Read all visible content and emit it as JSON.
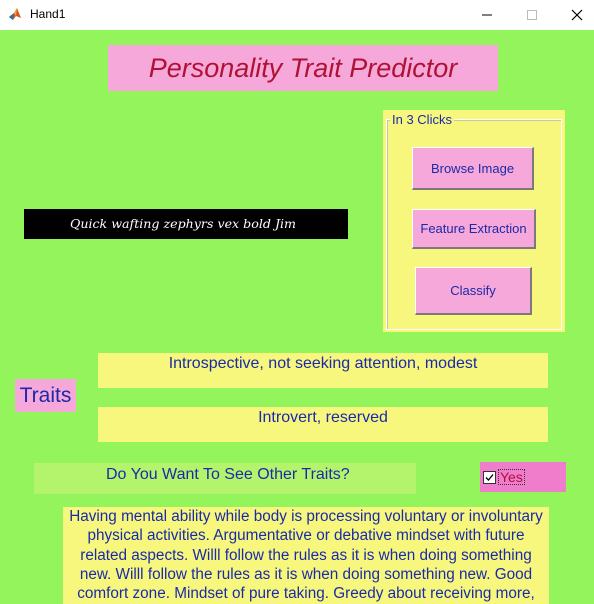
{
  "window": {
    "title": "Hand1",
    "icon": "matlab-icon"
  },
  "header": {
    "title": "Personality Trait Predictor"
  },
  "panel": {
    "legend": "In 3 Clicks",
    "buttons": {
      "browse": "Browse Image",
      "feature": "Feature Extraction",
      "classify": "Classify"
    }
  },
  "handwriting": {
    "text": "Quick wafting zephyrs vex bold Jim"
  },
  "traits": {
    "label": "Traits",
    "items": [
      "Introspective, not seeking attention, modest",
      "Introvert, reserved"
    ]
  },
  "other_traits": {
    "question": "Do You Want To See Other Traits?",
    "checkbox_label": "Yes",
    "checked": true
  },
  "description": "Having mental ability while body is processing voluntary or involuntary physical activities. Argumentative or debative mindset with future related aspects. Willl follow the rules as it is when doing something new. Willl follow the rules as it is when doing something new. Good comfort zone. Mindset of pure taking. Greedy about receiving more,",
  "colors": {
    "background": "#94f45c",
    "pink": "#f7a8da",
    "yellow": "#f7f77e",
    "text_blue": "#1a2aa8",
    "title_red": "#b01236"
  }
}
